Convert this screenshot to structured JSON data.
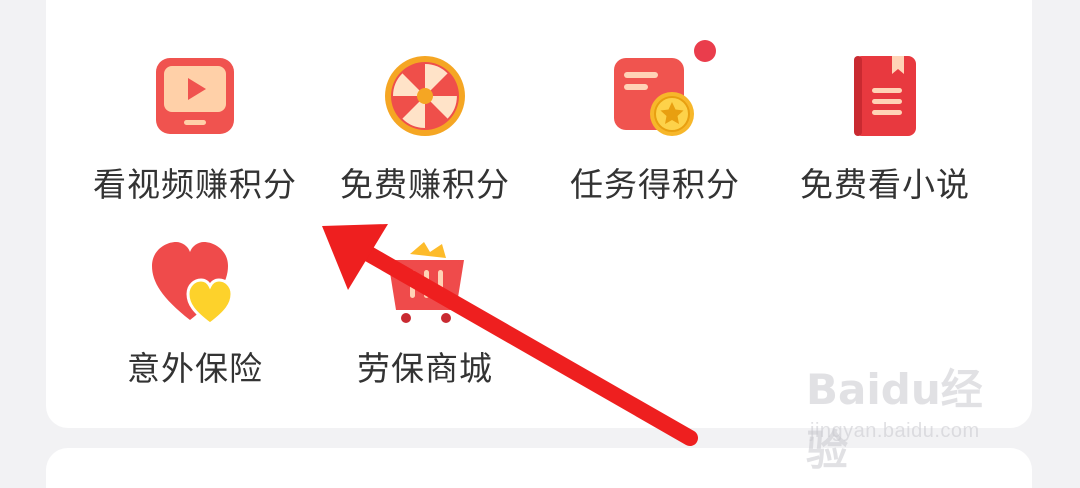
{
  "menu": {
    "items": [
      {
        "label": "看视频赚积分",
        "icon": "video-play-icon"
      },
      {
        "label": "免费赚积分",
        "icon": "prize-wheel-icon"
      },
      {
        "label": "任务得积分",
        "icon": "task-coin-icon",
        "has_notification_dot": true
      },
      {
        "label": "免费看小说",
        "icon": "book-icon"
      },
      {
        "label": "意外保险",
        "icon": "heart-insurance-icon"
      },
      {
        "label": "劳保商城",
        "icon": "shopping-basket-icon"
      }
    ]
  },
  "watermark": {
    "brand": "Baidu经验",
    "url": "jingyan.baidu.com"
  },
  "colors": {
    "accent_red": "#ea3d4c",
    "text": "#333333",
    "arrow": "#ee1f1f",
    "background": "#f2f2f4"
  }
}
